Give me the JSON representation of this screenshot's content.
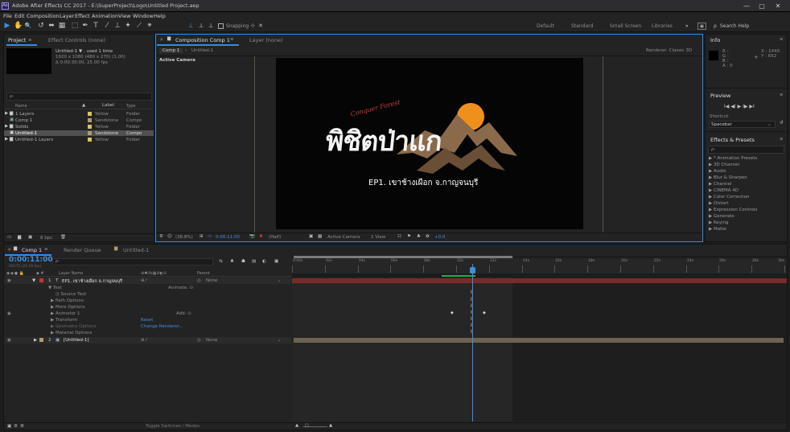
{
  "app": {
    "title": "Adobe After Effects CC 2017 - E:\\SuperProject\\Logo\\Untitled Project.aep",
    "logo": "Ae",
    "window_controls": [
      "—",
      "▢",
      "✕"
    ]
  },
  "menu": [
    "File",
    "Edit",
    "Composition",
    "Layer",
    "Effect",
    "Animation",
    "View",
    "Window",
    "Help"
  ],
  "toolbar": {
    "tools": [
      "▶",
      "✋",
      "🔍",
      "↺",
      "⬌",
      "▦",
      "⬚",
      "✒",
      "T",
      "⁄",
      "⊥",
      "✦",
      "⟋",
      "✴"
    ],
    "snapping": "Snapping",
    "workspaces": [
      "Default",
      "Standard",
      "Small Screen",
      "Libraries"
    ],
    "more": "»",
    "search": "Search Help"
  },
  "project": {
    "tab_label": "Project",
    "tab2_label": "Effect Controls (none)",
    "item_name": "Untitled-1 ▼ , used 1 time",
    "item_dims": "1920 x 1080 (480 x 270) (1.00)",
    "item_duration": "Δ 0:00:30:00, 25.00 fps",
    "search_placeholder": "ρ-",
    "columns": [
      "Name",
      "Label",
      "Type"
    ],
    "items": [
      {
        "name": "1 Layers",
        "label": "Yellow",
        "type": "Folder",
        "color": "#d8c45c"
      },
      {
        "name": "Comp 1",
        "label": "Sandstone",
        "type": "Compo",
        "color": "#b39a6e"
      },
      {
        "name": "Solids",
        "label": "Yellow",
        "type": "Folder",
        "color": "#d8c45c"
      },
      {
        "name": "Untitled-1",
        "label": "Sandstone",
        "type": "Compo",
        "color": "#b39a6e"
      },
      {
        "name": "Untitled-1 Layers",
        "label": "Yellow",
        "type": "Folder",
        "color": "#d8c45c"
      }
    ],
    "bpc": "8 bpc"
  },
  "composition": {
    "tab_label": "Composition Comp 1",
    "tab2_label": "Layer (none)",
    "crumbs": [
      "Comp 1",
      "Untitled-1"
    ],
    "renderer": "Renderer:  Classic 3D",
    "active_camera": "Active Camera",
    "footer": {
      "zoom": "(38.8%)",
      "timecode": "0:00:11:00",
      "resolution": "(Half)",
      "view": "Active Camera",
      "views": "1 View",
      "exposure": "+0.0"
    },
    "logo_text": "EP1. เขาช้างเผือก จ.กาญจนบุรี",
    "logo_main": "พิชิตป่าแก",
    "logo_accent": "Conquer Forest"
  },
  "info": {
    "title": "Info",
    "r": "R :",
    "g": "G :",
    "b": "B :",
    "a": "A : 0",
    "x": "X : 1440",
    "y": "Y : 652"
  },
  "preview": {
    "title": "Preview",
    "controls": "I◀  ◀I  ▶  I▶  ▶I"
  },
  "shortcut": {
    "label": "Shortcut",
    "value": "Spacebar"
  },
  "effects": {
    "title": "Effects & Presets",
    "search": "ρ-",
    "items": [
      "▶ * Animation Presets",
      "▶ 3D Channel",
      "▶ Audio",
      "▶ Blur & Sharpen",
      "▶ Channel",
      "▶ CINEMA 4D",
      "▶ Color Correction",
      "▶ Distort",
      "▶ Expression Controls",
      "▶ Generate",
      "▶ Keying",
      "▶ Matte"
    ]
  },
  "timeline": {
    "tabs": [
      "Comp 1",
      "Render Queue",
      "Untitled-1"
    ],
    "timecode": "0:00:11:00",
    "timecode_sub": "00275 (25.00 fps)",
    "search": "ρ-",
    "col_layer": "Layer Name",
    "col_parent": "Parent",
    "parent_none": "None",
    "layer1": {
      "num": "1",
      "name": "EP1. เขาช้างเผือก จ.กาญจนบุรี",
      "switch": "⊕ ⁄"
    },
    "props": [
      {
        "name": "▼ Text",
        "indent": 0,
        "value": "Animate: ⊙"
      },
      {
        "name": "◷ Source Text",
        "indent": 2,
        "value": ""
      },
      {
        "name": "▶ Path Options",
        "indent": 1,
        "value": ""
      },
      {
        "name": "▶ More Options",
        "indent": 1,
        "value": ""
      },
      {
        "name": "▶ Animator 1",
        "indent": 1,
        "value": "Add: ⊙"
      },
      {
        "name": "▶ Transform",
        "indent": 1,
        "value": "Reset"
      },
      {
        "name": "▶ Geometry Options",
        "indent": 1,
        "value": "Change Renderer..."
      },
      {
        "name": "▶ Material Options",
        "indent": 1,
        "value": ""
      }
    ],
    "layer2": {
      "num": "2",
      "name": "[Untitled-1]",
      "switch": "⊕ ⁄"
    },
    "ticks": [
      "0:00s",
      "02s",
      "04s",
      "06s",
      "08s",
      "10s",
      "12s",
      "14s",
      "16s",
      "18s",
      "20s",
      "22s",
      "24s",
      "26s",
      "28s",
      "30s"
    ],
    "toggle": "Toggle Switches / Modes"
  },
  "colors": {
    "accent": "#2d8ceb",
    "layer1_bar": "#7a2a2a",
    "layer2_bar": "#6e6350",
    "logo_orange": "#f0901c"
  }
}
